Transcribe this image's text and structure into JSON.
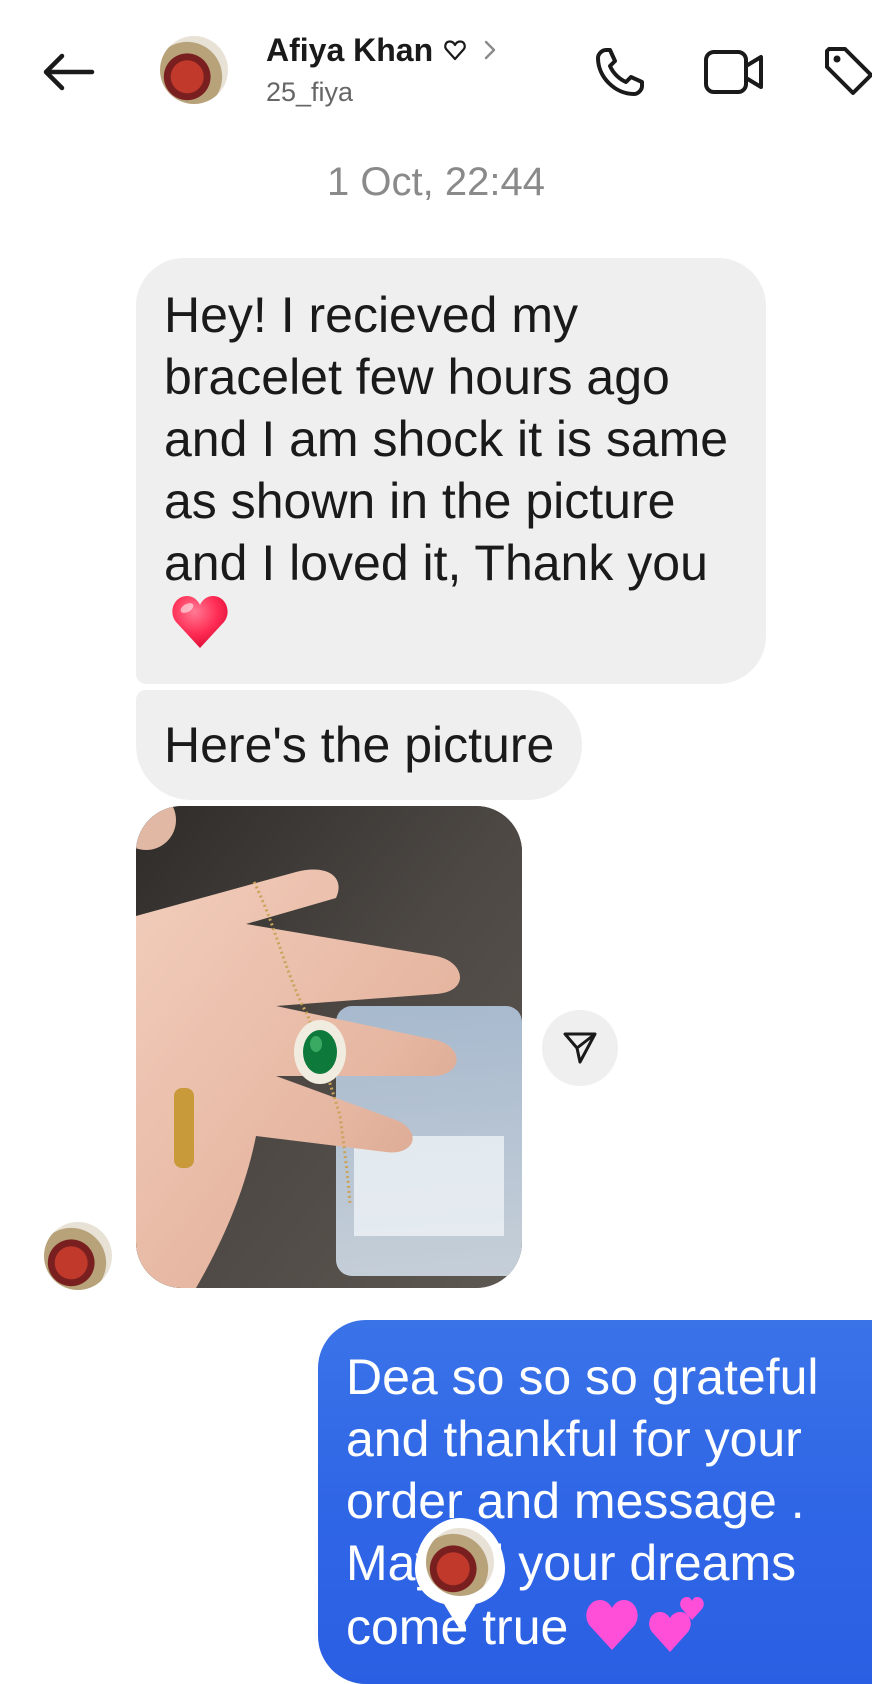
{
  "header": {
    "back_icon": "arrow-left-icon",
    "contact_name": "Afiya Khan",
    "name_badge_icon": "heart-outline-icon",
    "name_chevron_icon": "chevron-right-icon",
    "username": "25_fiya",
    "call_icon": "phone-icon",
    "video_icon": "video-camera-icon",
    "tag_icon": "tag-icon"
  },
  "thread": {
    "timestamp": "1 Oct, 22:44",
    "incoming": [
      {
        "text": "Hey! I recieved my bracelet few hours ago and I am shock it is same as shown in the picture and I  loved it, Thank you",
        "emoji": "red-heart"
      },
      {
        "text": "Here's the picture"
      }
    ],
    "photo": {
      "subject": "hand-holding-bracelet",
      "share_icon": "send-paper-plane-icon"
    },
    "outgoing": [
      {
        "text": "Dea so so so grateful and thankful for your order and message . May all your dreams come true",
        "emoji": "pink-hearts"
      }
    ]
  },
  "colors": {
    "incoming_bubble": "#efefef",
    "outgoing_bubble": "#2f66e6",
    "timestamp_text": "#8a8a8a",
    "username_text": "#666666"
  }
}
